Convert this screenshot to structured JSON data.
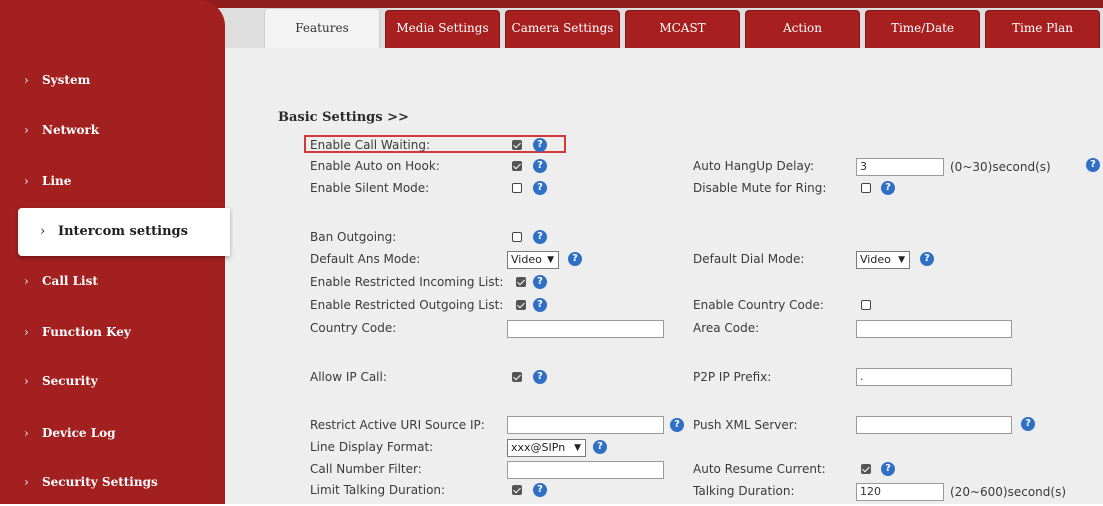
{
  "tabs": [
    "Features",
    "Media Settings",
    "Camera Settings",
    "MCAST",
    "Action",
    "Time/Date",
    "Time Plan"
  ],
  "sidebar": {
    "items": [
      {
        "label": "System"
      },
      {
        "label": "Network"
      },
      {
        "label": "Line"
      },
      {
        "label": "Intercom settings",
        "active": true
      },
      {
        "label": "Call List"
      },
      {
        "label": "Function Key"
      },
      {
        "label": "Security"
      },
      {
        "label": "Device Log"
      },
      {
        "label": "Security Settings"
      }
    ]
  },
  "section": {
    "heading": "Basic Settings >>"
  },
  "form": {
    "enable_call_waiting": {
      "label": "Enable Call Waiting:",
      "checked": true
    },
    "enable_auto_on_hook": {
      "label": "Enable Auto on Hook:",
      "checked": true
    },
    "enable_silent_mode": {
      "label": "Enable Silent Mode:",
      "checked": false
    },
    "ban_outgoing": {
      "label": "Ban Outgoing:",
      "checked": false
    },
    "default_ans_mode": {
      "label": "Default Ans Mode:",
      "value": "Video"
    },
    "enable_restricted_incoming": {
      "label": "Enable Restricted Incoming List:",
      "checked": true
    },
    "enable_restricted_outgoing": {
      "label": "Enable Restricted Outgoing List:",
      "checked": true
    },
    "country_code": {
      "label": "Country Code:",
      "value": ""
    },
    "allow_ip_call": {
      "label": "Allow IP Call:",
      "checked": true
    },
    "restrict_active_uri": {
      "label": "Restrict Active URI Source IP:",
      "value": ""
    },
    "line_display_format": {
      "label": "Line Display Format:",
      "value": "xxx@SIPn"
    },
    "call_number_filter": {
      "label": "Call Number Filter:",
      "value": ""
    },
    "limit_talking_duration": {
      "label": "Limit Talking Duration:",
      "checked": true
    },
    "auto_hangup_delay": {
      "label": "Auto HangUp Delay:",
      "value": "3",
      "unit": "(0~30)second(s)"
    },
    "disable_mute_for_ring": {
      "label": "Disable Mute for Ring:",
      "checked": false
    },
    "default_dial_mode": {
      "label": "Default Dial Mode:",
      "value": "Video"
    },
    "enable_country_code": {
      "label": "Enable Country Code:",
      "checked": false
    },
    "area_code": {
      "label": "Area Code:",
      "value": ""
    },
    "p2p_ip_prefix": {
      "label": "P2P IP Prefix:",
      "value": "."
    },
    "push_xml_server": {
      "label": "Push XML Server:",
      "value": ""
    },
    "auto_resume_current": {
      "label": "Auto Resume Current:",
      "checked": true
    },
    "talking_duration": {
      "label": "Talking Duration:",
      "value": "120",
      "unit": "(20~600)second(s)"
    }
  },
  "colors": {
    "sidebar": "#a32020",
    "tab": "#a81f1f",
    "help_icon": "#2f6fc4",
    "highlight": "#d23a3a",
    "content_bg": "#eeeeee"
  },
  "icons": {
    "help": "question-circle-icon",
    "sidebar_chevron": "chevron-right-icon",
    "select_arrow": "chevron-down-icon"
  }
}
